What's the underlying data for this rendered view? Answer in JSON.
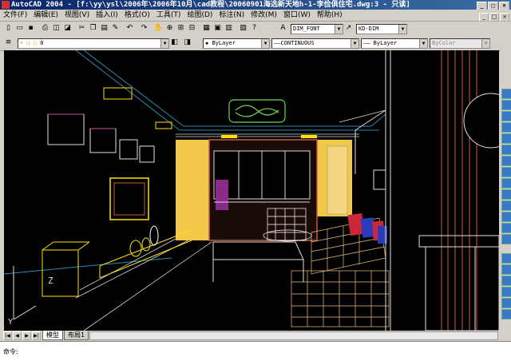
{
  "window": {
    "title": "AutoCAD 2004 - [f:\\yy\\ysl\\2006年\\2006年10月\\cad教程\\20060901海选新天地h-1-李俭俱住宅.dwg:3 - 只读]",
    "minimize": "_",
    "maximize": "□",
    "close": "×"
  },
  "menu": [
    "文件(F)",
    "编辑(E)",
    "视图(V)",
    "插入(I)",
    "格式(O)",
    "工具(T)",
    "绘图(D)",
    "标注(N)",
    "修改(M)",
    "窗口(W)",
    "帮助(H)"
  ],
  "toolbar_std": {
    "text_style": "DIM_FONT",
    "dim_style": "KD-DIM"
  },
  "toolbar_props": {
    "layer": "0",
    "color": "ByLayer",
    "linetype": "CONTINUOUS",
    "lineweight": "ByLayer",
    "plotstyle": "ByColor"
  },
  "ucs": {
    "z_label": "Z",
    "y_label": "Y"
  },
  "tabs": {
    "model": "模型",
    "layout": "布局1"
  },
  "command": {
    "prompt": "命令:"
  }
}
